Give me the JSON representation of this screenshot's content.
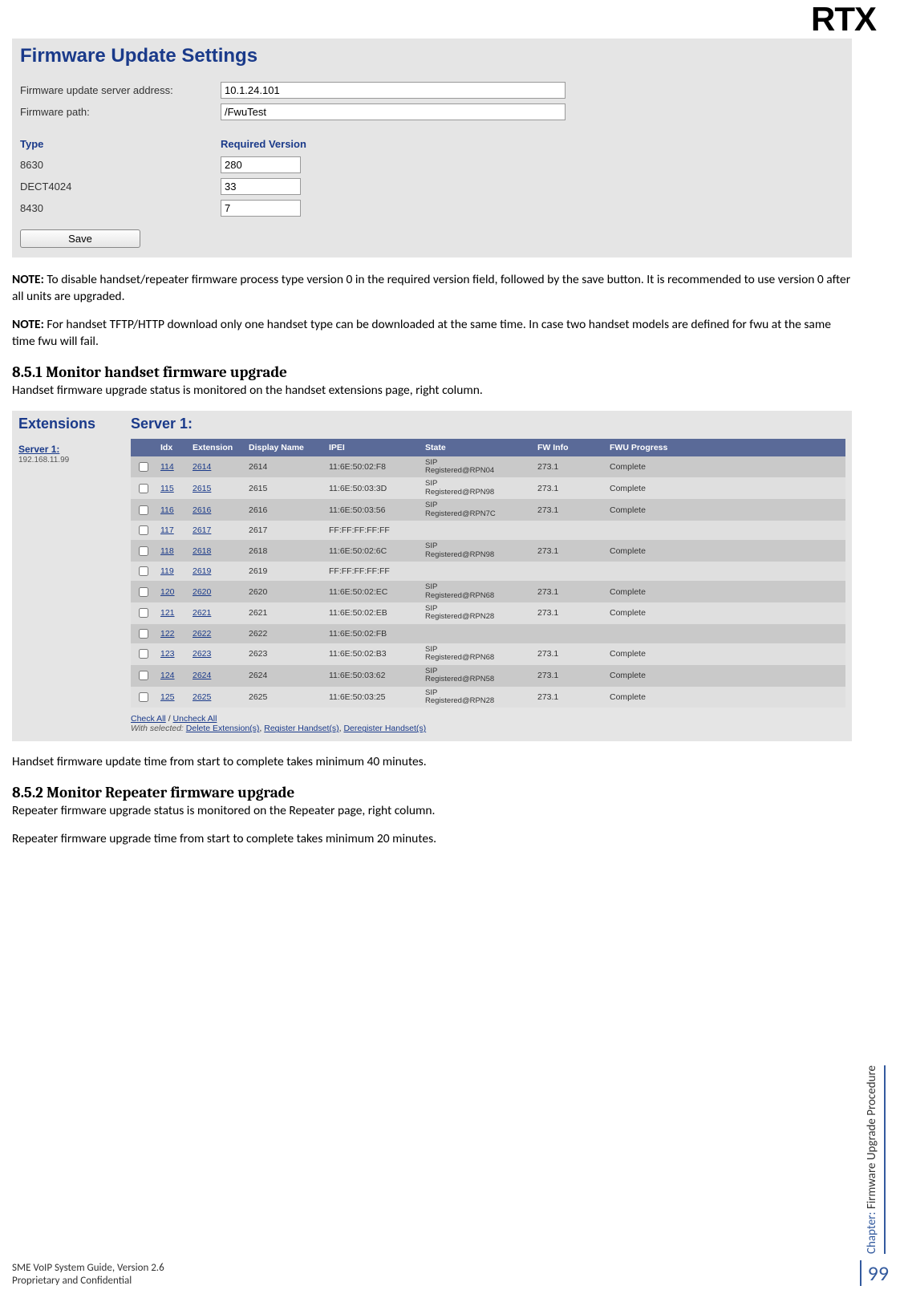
{
  "logo": "RTX",
  "firmware_panel": {
    "title": "Firmware Update Settings",
    "server_label": "Firmware update server address:",
    "server_value": "10.1.24.101",
    "path_label": "Firmware path:",
    "path_value": "/FwuTest",
    "type_header": "Type",
    "version_header": "Required Version",
    "rows": [
      {
        "type": "8630",
        "version": "280"
      },
      {
        "type": "DECT4024",
        "version": "33"
      },
      {
        "type": "8430",
        "version": "7"
      }
    ],
    "save_label": "Save"
  },
  "note1_bold": "NOTE:",
  "note1_text": " To disable handset/repeater firmware process type version 0 in the required version field, followed by the save button. It is recommended to use version 0 after all units are upgraded.",
  "note2_bold": "NOTE:",
  "note2_text": " For handset TFTP/HTTP download only one handset type can be downloaded at the same time. In case two handset models are defined for fwu at the same time fwu will fail.",
  "section851_title": "8.5.1  Monitor handset firmware upgrade",
  "section851_intro": "Handset firmware upgrade status is monitored on the handset extensions page, right column.",
  "extensions": {
    "side_title": "Extensions",
    "server_link": "Server 1:",
    "server_ip": "192.168.11.99",
    "main_title": "Server 1:",
    "headers": [
      "",
      "Idx",
      "Extension",
      "Display Name",
      "IPEI",
      "State",
      "FW Info",
      "FWU Progress"
    ],
    "rows": [
      {
        "idx": "114",
        "ext": "2614",
        "dn": "2614",
        "ipei": "11:6E:50:02:F8",
        "state": "SIP\nRegistered@RPN04",
        "fw": "273.1",
        "prog": "Complete",
        "alt": "dark"
      },
      {
        "idx": "115",
        "ext": "2615",
        "dn": "2615",
        "ipei": "11:6E:50:03:3D",
        "state": "SIP\nRegistered@RPN98",
        "fw": "273.1",
        "prog": "Complete",
        "alt": "light"
      },
      {
        "idx": "116",
        "ext": "2616",
        "dn": "2616",
        "ipei": "11:6E:50:03:56",
        "state": "SIP\nRegistered@RPN7C",
        "fw": "273.1",
        "prog": "Complete",
        "alt": "dark"
      },
      {
        "idx": "117",
        "ext": "2617",
        "dn": "2617",
        "ipei": "FF:FF:FF:FF:FF",
        "state": "",
        "fw": "",
        "prog": "",
        "alt": "light"
      },
      {
        "idx": "118",
        "ext": "2618",
        "dn": "2618",
        "ipei": "11:6E:50:02:6C",
        "state": "SIP\nRegistered@RPN98",
        "fw": "273.1",
        "prog": "Complete",
        "alt": "dark"
      },
      {
        "idx": "119",
        "ext": "2619",
        "dn": "2619",
        "ipei": "FF:FF:FF:FF:FF",
        "state": "",
        "fw": "",
        "prog": "",
        "alt": "light"
      },
      {
        "idx": "120",
        "ext": "2620",
        "dn": "2620",
        "ipei": "11:6E:50:02:EC",
        "state": "SIP\nRegistered@RPN68",
        "fw": "273.1",
        "prog": "Complete",
        "alt": "dark"
      },
      {
        "idx": "121",
        "ext": "2621",
        "dn": "2621",
        "ipei": "11:6E:50:02:EB",
        "state": "SIP\nRegistered@RPN28",
        "fw": "273.1",
        "prog": "Complete",
        "alt": "light"
      },
      {
        "idx": "122",
        "ext": "2622",
        "dn": "2622",
        "ipei": "11:6E:50:02:FB",
        "state": "",
        "fw": "",
        "prog": "",
        "alt": "dark"
      },
      {
        "idx": "123",
        "ext": "2623",
        "dn": "2623",
        "ipei": "11:6E:50:02:B3",
        "state": "SIP\nRegistered@RPN68",
        "fw": "273.1",
        "prog": "Complete",
        "alt": "light"
      },
      {
        "idx": "124",
        "ext": "2624",
        "dn": "2624",
        "ipei": "11:6E:50:03:62",
        "state": "SIP\nRegistered@RPN58",
        "fw": "273.1",
        "prog": "Complete",
        "alt": "dark"
      },
      {
        "idx": "125",
        "ext": "2625",
        "dn": "2625",
        "ipei": "11:6E:50:03:25",
        "state": "SIP\nRegistered@RPN28",
        "fw": "273.1",
        "prog": "Complete",
        "alt": "light"
      }
    ],
    "check_all": "Check All",
    "uncheck_all": "Uncheck All",
    "with_selected": "With selected:",
    "action_delete": "Delete Extension(s)",
    "action_register": "Register Handset(s)",
    "action_deregister": "Deregister Handset(s)"
  },
  "section851_after": "Handset firmware update time from start to complete takes minimum 40 minutes.",
  "section852_title": "8.5.2  Monitor Repeater firmware upgrade",
  "section852_p1": "Repeater firmware upgrade status is monitored on the Repeater page, right column.",
  "section852_p2": "Repeater firmware upgrade time from start to complete takes minimum 20 minutes.",
  "side_chapter_label": "Chapter:",
  "side_chapter_text": " Firmware Upgrade Procedure",
  "page_number": "99",
  "footer_line1": "SME VoIP System Guide, Version 2.6",
  "footer_line2": "Proprietary and Confidential"
}
